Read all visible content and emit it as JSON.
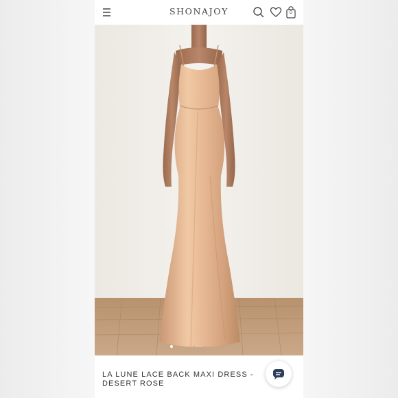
{
  "header": {
    "logo_text": "SHONAJOY",
    "bag_count": "0",
    "icons": [
      "menu-icon",
      "search-icon",
      "heart-icon",
      "bag-icon"
    ]
  },
  "product": {
    "title_line1": "LA LUNE LACE BACK MAXI DRESS -",
    "title_line2": "DESERT ROSE"
  },
  "carousel": {
    "slide_count": 8,
    "active_index": 1
  },
  "colors": {
    "dress": "#e5b892",
    "floor": "#c39f7c",
    "wall": "#f1efeb",
    "chat_icon": "#2c3e5a"
  },
  "chat": {
    "icon": "chat-icon"
  }
}
